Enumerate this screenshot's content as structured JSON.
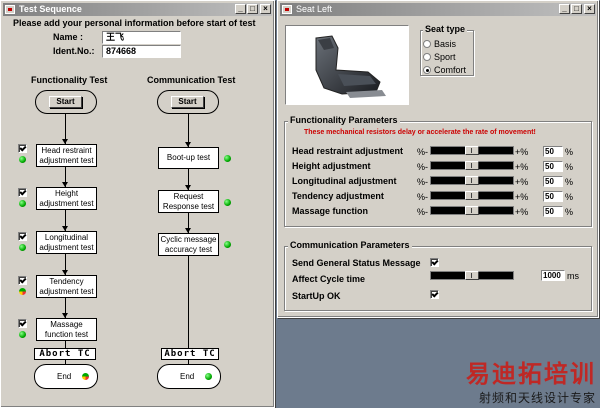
{
  "windows": {
    "left": {
      "title": "Test Sequence",
      "instruction": "Please add your personal information before start of test",
      "name_label": "Name :",
      "name_value": "王飞",
      "ident_label": "Ident.No.:",
      "ident_value": "874668",
      "func_heading": "Functionality Test",
      "comm_heading": "Communication Test",
      "start_label": "Start",
      "end_label": "End",
      "abort_label": "Abort TC",
      "func_steps": [
        "Head restraint adjustment test",
        "Height adjustment test",
        "Longitudinal adjustment test",
        "Tendency adjustment test",
        "Massage function test"
      ],
      "comm_steps": [
        "Boot-up test",
        "Request Response test",
        "Cyclic message accuracy test"
      ]
    },
    "right": {
      "title": "Seat Left",
      "seat_type_title": "Seat type",
      "seat_types": [
        "Basis",
        "Sport",
        "Comfort"
      ],
      "seat_type_selected": "Comfort",
      "func_group_title": "Functionality Parameters",
      "warning": "These mechanical resistors delay or accelerate the rate of movement!",
      "minus_label": "%-",
      "plus_label": "+%",
      "pct_unit": "%",
      "params": [
        {
          "label": "Head restraint adjustment",
          "value": "50"
        },
        {
          "label": "Height adjustment",
          "value": "50"
        },
        {
          "label": "Longitudinal adjustment",
          "value": "50"
        },
        {
          "label": "Tendency adjustment",
          "value": "50"
        },
        {
          "label": "Massage function",
          "value": "50"
        }
      ],
      "comm_group_title": "Communication Parameters",
      "send_status_label": "Send General Status Message",
      "send_status_checked": true,
      "cycle_label": "Affect Cycle time",
      "cycle_value": "1000",
      "cycle_unit": "ms",
      "startup_label": "StartUp OK",
      "startup_checked": true
    }
  },
  "titlebar_buttons": [
    "_",
    "□",
    "×"
  ],
  "watermark": {
    "line1": "易迪拓培训",
    "line2": "射频和天线设计专家"
  },
  "colors": {
    "active_title": "#0a246a",
    "inactive_title": "#808080",
    "warning": "#cc0000",
    "led_on": "#00aa00",
    "watermark": "#c8201a"
  }
}
